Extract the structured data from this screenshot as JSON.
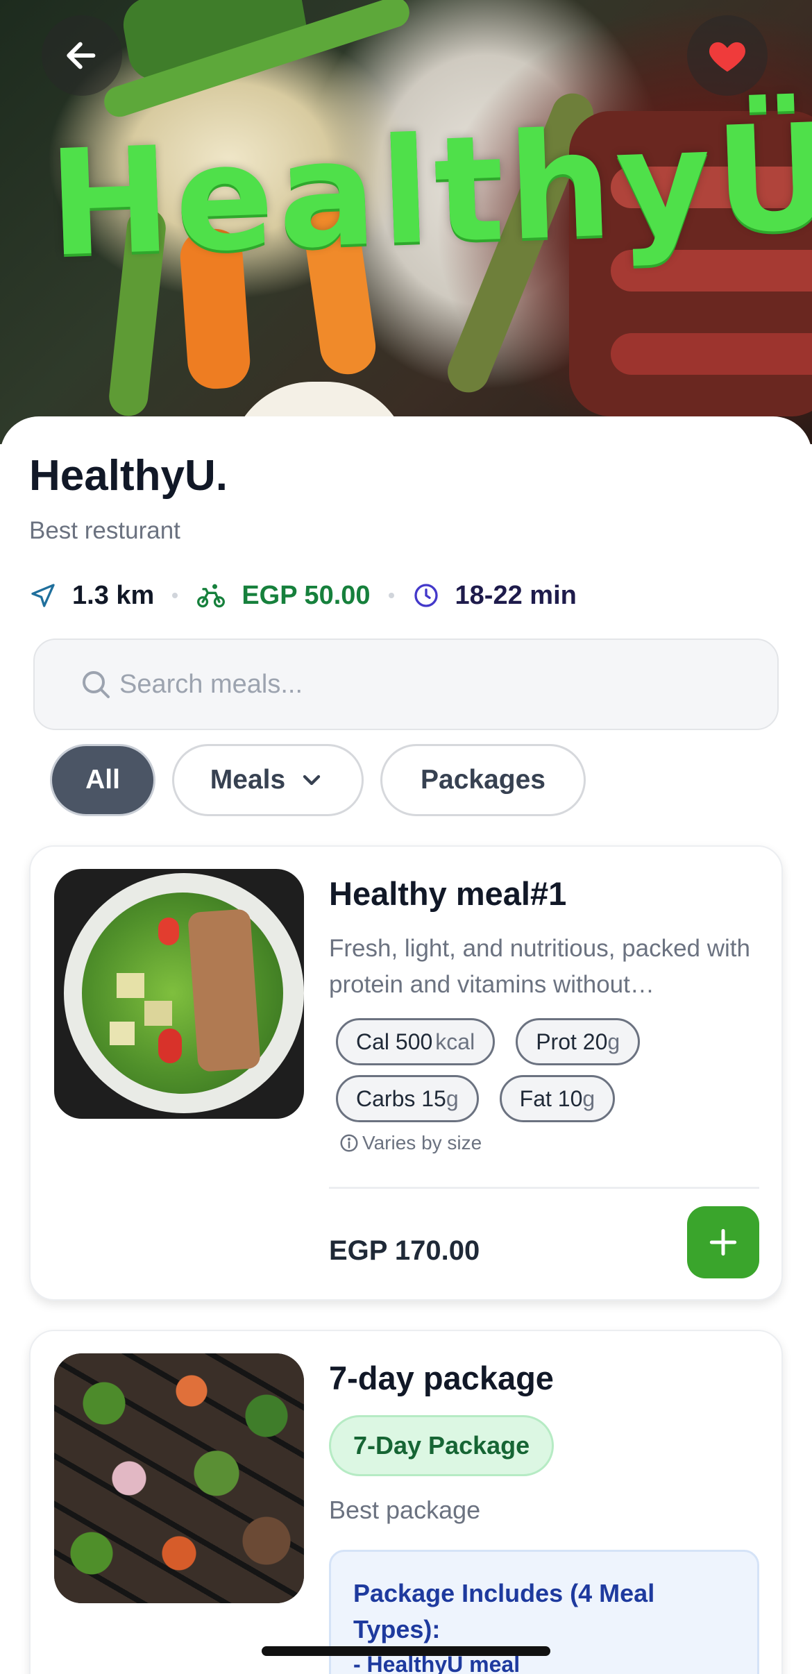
{
  "hero": {
    "logo_text": "HealthyÜ"
  },
  "restaurant": {
    "name": "HealthyU.",
    "tagline": "Best resturant",
    "distance": "1.3 km",
    "delivery_fee": "EGP 50.00",
    "delivery_time": "18-22 min"
  },
  "search": {
    "placeholder": "Search meals..."
  },
  "filters": {
    "all": "All",
    "meals": "Meals",
    "packages": "Packages",
    "selected": "All"
  },
  "items": [
    {
      "title": "Healthy meal#1",
      "description": "Fresh, light, and nutritious, packed with protein and vitamins without…",
      "nutrition": {
        "cal_label": "Cal 500",
        "cal_unit": "kcal",
        "prot_label": "Prot 20",
        "prot_unit": "g",
        "carbs_label": "Carbs 15",
        "carbs_unit": "g",
        "fat_label": "Fat 10",
        "fat_unit": "g"
      },
      "varies_note": "Varies by size",
      "price": "EGP 170.00"
    },
    {
      "title": "7-day package",
      "badge": "7-Day Package",
      "description": "Best package",
      "includes_title": "Package Includes (4 Meal Types):",
      "includes_first": "- HealthyU meal"
    }
  ],
  "colors": {
    "accent_green": "#3aa52c",
    "chip_active": "#4b5565",
    "favorite_red": "#ef3b3b",
    "logo_green": "#4fe04a",
    "info_blue": "#1e3a9e"
  }
}
